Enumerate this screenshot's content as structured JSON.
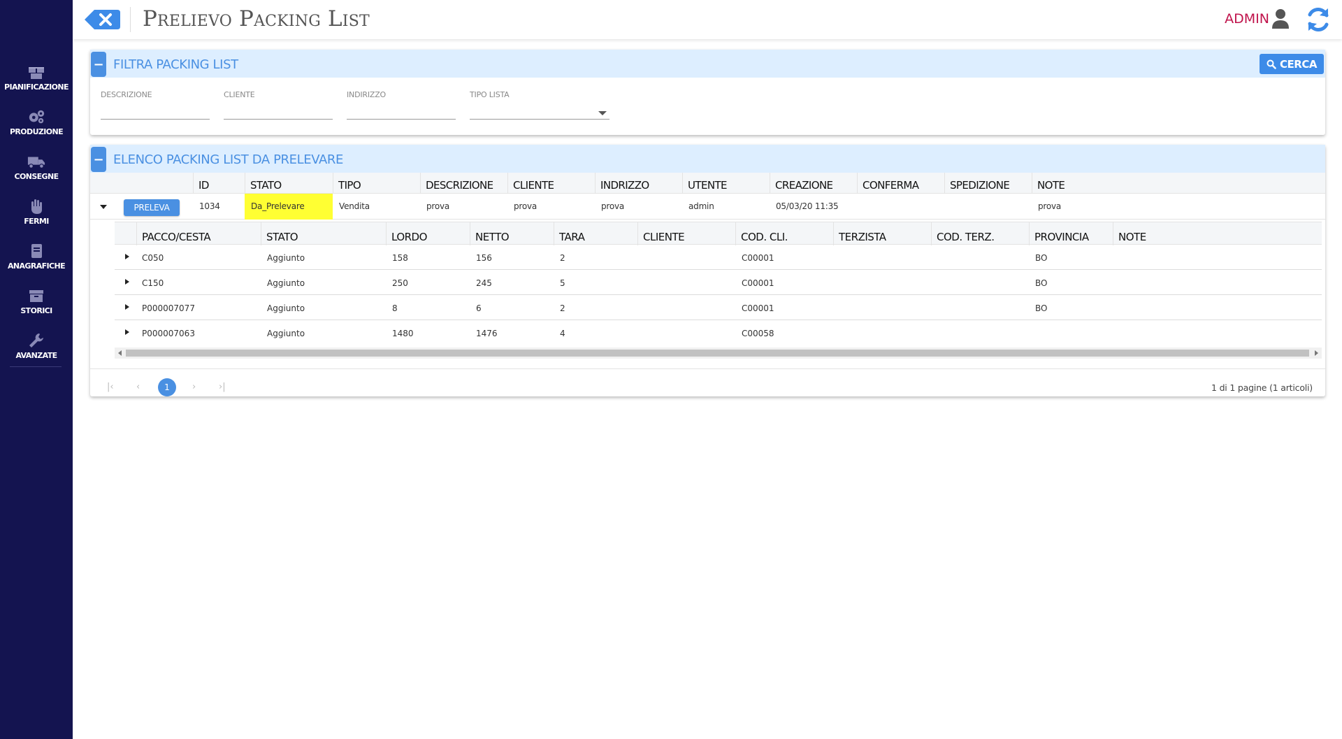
{
  "header": {
    "title": "Prelievo Packing List",
    "user": "ADMIN"
  },
  "sidebar": {
    "items": [
      {
        "label": "PIANIFICAZIONE",
        "icon": "boxes-icon"
      },
      {
        "label": "PRODUZIONE",
        "icon": "cogs-icon"
      },
      {
        "label": "CONSEGNE",
        "icon": "truck-icon"
      },
      {
        "label": "FERMI",
        "icon": "hand-icon"
      },
      {
        "label": "ANAGRAFICHE",
        "icon": "book-icon"
      },
      {
        "label": "STORICI",
        "icon": "archive-icon"
      },
      {
        "label": "AVANZATE",
        "icon": "wrench-icon"
      }
    ]
  },
  "filter": {
    "title": "FILTRA PACKING LIST",
    "search_label": "CERCA",
    "fields": [
      {
        "label": "DESCRIZIONE",
        "value": ""
      },
      {
        "label": "CLIENTE",
        "value": ""
      },
      {
        "label": "INDIRIZZO",
        "value": ""
      },
      {
        "label": "TIPO LISTA",
        "value": ""
      }
    ]
  },
  "list": {
    "title": "ELENCO PACKING LIST DA PRELEVARE",
    "columns": [
      "ID",
      "STATO",
      "TIPO",
      "DESCRIZIONE",
      "CLIENTE",
      "INDRIZZO",
      "UTENTE",
      "CREAZIONE",
      "CONFERMA",
      "SPEDIZIONE",
      "NOTE"
    ],
    "action_label": "PRELEVA",
    "row": {
      "id": "1034",
      "stato": "Da_Prelevare",
      "tipo": "Vendita",
      "descrizione": "prova",
      "cliente": "prova",
      "indirizzo": "prova",
      "utente": "admin",
      "creazione": "05/03/20 11:35",
      "conferma": "",
      "spedizione": "",
      "note": "prova"
    },
    "detail_columns": [
      "PACCO/CESTA",
      "STATO",
      "LORDO",
      "NETTO",
      "TARA",
      "CLIENTE",
      "COD. CLI.",
      "TERZISTA",
      "COD. TERZ.",
      "PROVINCIA",
      "NOTE"
    ],
    "detail_rows": [
      {
        "pacco": "C050",
        "stato": "Aggiunto",
        "lordo": "158",
        "netto": "156",
        "tara": "2",
        "cliente": "",
        "cod_cli": "C00001",
        "terzista": "",
        "cod_terz": "",
        "provincia": "BO",
        "note": ""
      },
      {
        "pacco": "C150",
        "stato": "Aggiunto",
        "lordo": "250",
        "netto": "245",
        "tara": "5",
        "cliente": "",
        "cod_cli": "C00001",
        "terzista": "",
        "cod_terz": "",
        "provincia": "BO",
        "note": ""
      },
      {
        "pacco": "P000007077",
        "stato": "Aggiunto",
        "lordo": "8",
        "netto": "6",
        "tara": "2",
        "cliente": "",
        "cod_cli": "C00001",
        "terzista": "",
        "cod_terz": "",
        "provincia": "BO",
        "note": ""
      },
      {
        "pacco": "P000007063",
        "stato": "Aggiunto",
        "lordo": "1480",
        "netto": "1476",
        "tara": "4",
        "cliente": "",
        "cod_cli": "C00058",
        "terzista": "",
        "cod_terz": "",
        "provincia": "",
        "note": ""
      }
    ]
  },
  "pager": {
    "current_page": "1",
    "info": "1 di 1 pagine (1 articoli)"
  },
  "colors": {
    "sidebar": "#141450",
    "accent": "#4a90e2",
    "user": "#c0144c",
    "highlight": "#ffff33"
  }
}
